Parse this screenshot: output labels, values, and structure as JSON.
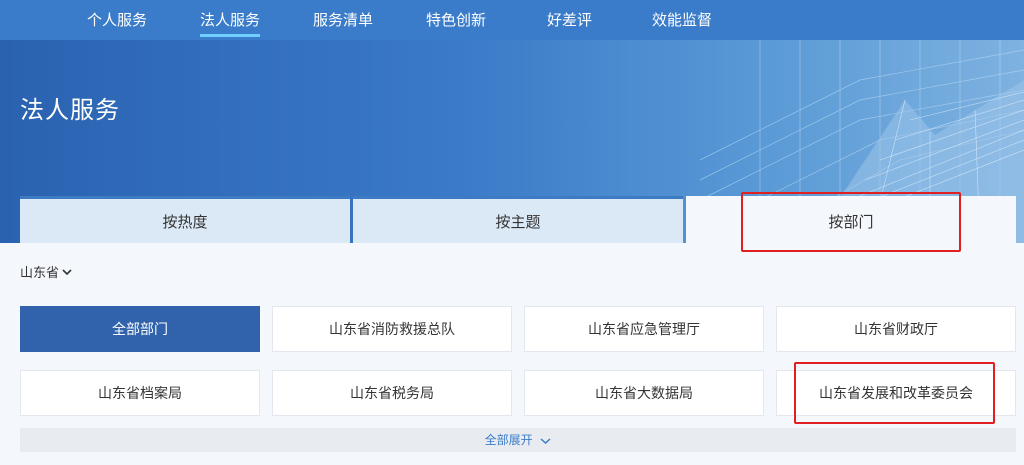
{
  "nav": {
    "items": [
      {
        "label": "个人服务"
      },
      {
        "label": "法人服务"
      },
      {
        "label": "服务清单"
      },
      {
        "label": "特色创新"
      },
      {
        "label": "好差评"
      },
      {
        "label": "效能监督"
      }
    ],
    "active_index": 1
  },
  "banner": {
    "title": "法人服务"
  },
  "tabs": [
    {
      "label": "按热度"
    },
    {
      "label": "按主题"
    },
    {
      "label": "按部门"
    }
  ],
  "active_tab": 2,
  "region": {
    "label": "山东省",
    "icon": "chevron-down-icon"
  },
  "departments": [
    {
      "label": "全部部门",
      "active": true
    },
    {
      "label": "山东省消防救援总队"
    },
    {
      "label": "山东省应急管理厅"
    },
    {
      "label": "山东省财政厅"
    },
    {
      "label": "山东省档案局"
    },
    {
      "label": "山东省税务局"
    },
    {
      "label": "山东省大数据局"
    },
    {
      "label": "山东省发展和改革委员会"
    }
  ],
  "expand": {
    "label": "全部展开",
    "icon": "chevron-down-icon"
  },
  "colors": {
    "nav_bg": "#3a7cc9",
    "accent": "#3163ad",
    "highlight": "#e02020",
    "underline": "#6fd0ff"
  }
}
